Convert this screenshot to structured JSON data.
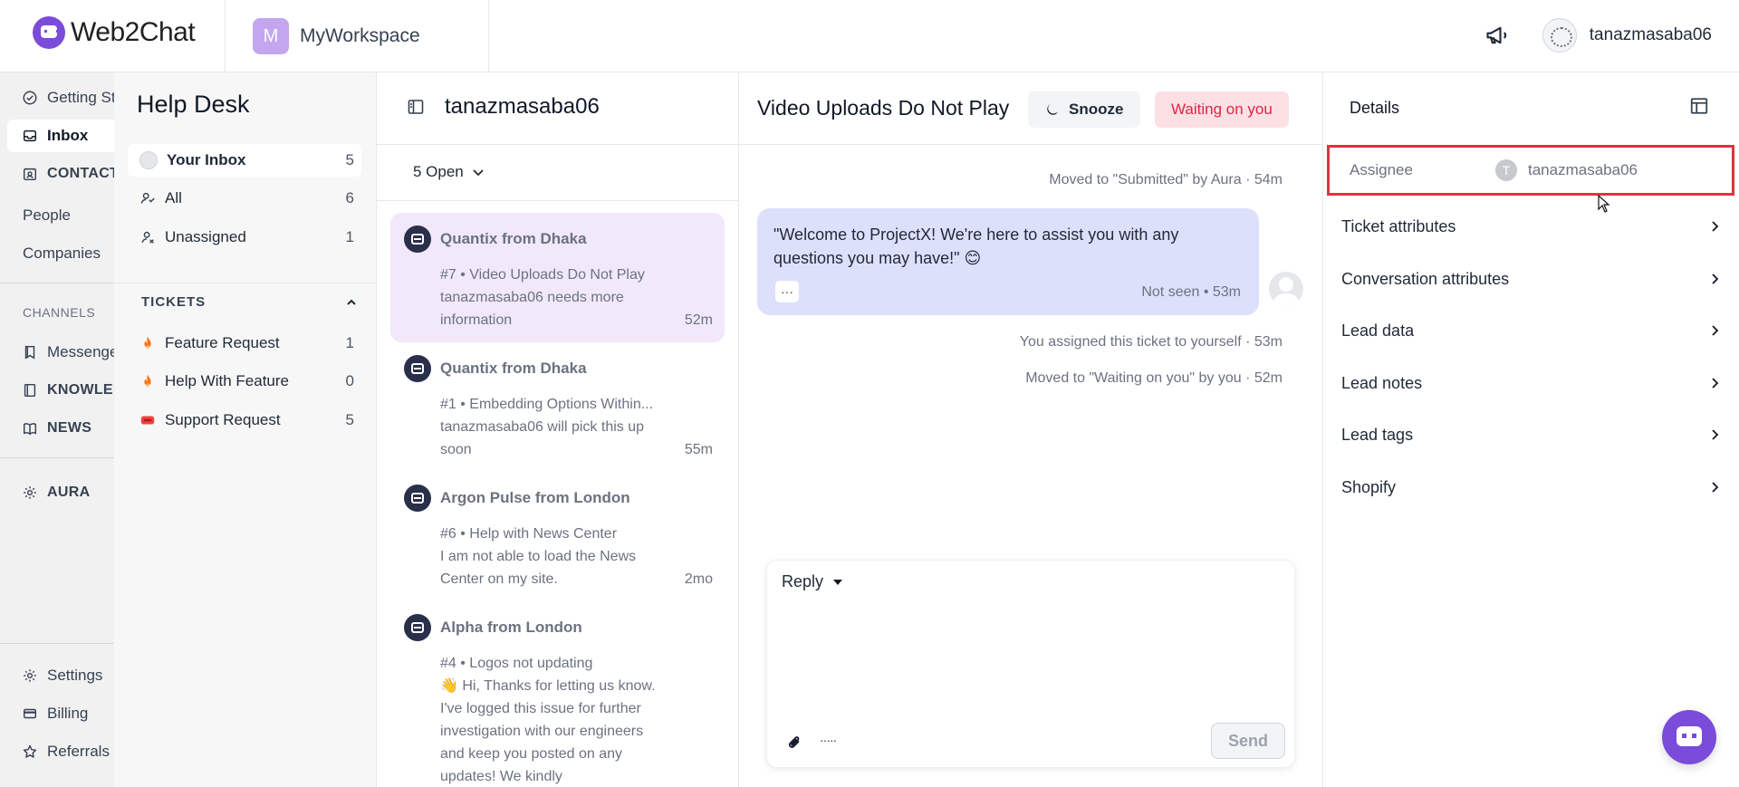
{
  "topbar": {
    "brand_name": "Web2Chat",
    "workspace_initial": "M",
    "workspace_name": "MyWorkspace",
    "username": "tanazmasaba06"
  },
  "leftnav": {
    "items": [
      {
        "label": "Getting Started",
        "icon": "check-circle-icon"
      },
      {
        "label": "Inbox",
        "icon": "inbox-icon"
      },
      {
        "label": "CONTACTS",
        "icon": "contacts-icon"
      },
      {
        "label": "People"
      },
      {
        "label": "Companies"
      }
    ],
    "channels_heading": "CHANNELS",
    "channels": [
      {
        "label": "Messenger",
        "icon": "messenger-icon"
      },
      {
        "label": "KNOWLEDGE",
        "icon": "book-icon"
      },
      {
        "label": "NEWS",
        "icon": "news-icon"
      }
    ],
    "aura_label": "AURA",
    "bottom": [
      {
        "label": "Settings",
        "icon": "gear-icon"
      },
      {
        "label": "Billing",
        "icon": "card-icon"
      },
      {
        "label": "Referrals",
        "icon": "star-icon"
      }
    ]
  },
  "helpdesk": {
    "title": "Help Desk",
    "inboxes": [
      {
        "label": "Your Inbox",
        "count": "5"
      },
      {
        "label": "All",
        "count": "6"
      },
      {
        "label": "Unassigned",
        "count": "1"
      }
    ],
    "tickets_heading": "TICKETS",
    "tickets": [
      {
        "label": "Feature Request",
        "count": "1",
        "color": "#f97316"
      },
      {
        "label": "Help With Feature",
        "count": "0",
        "color": "#f97316"
      },
      {
        "label": "Support Request",
        "count": "5",
        "color": "#ef4444"
      }
    ]
  },
  "convlist": {
    "title": "tanazmasaba06",
    "filter": "5 Open",
    "conversations": [
      {
        "from": "Quantix from Dhaka",
        "subject": "#7 • Video Uploads Do Not Play",
        "preview": "tanazmasaba06 needs more information",
        "time": "52m"
      },
      {
        "from": "Quantix from Dhaka",
        "subject": "#1 • Embedding Options Within...",
        "preview": "tanazmasaba06 will pick this up soon",
        "time": "55m"
      },
      {
        "from": "Argon Pulse from London",
        "subject": "#6 • Help with News Center",
        "preview": "I am not able to load the News Center on my site.",
        "time": "2mo"
      },
      {
        "from": "Alpha from London",
        "subject": "#4 • Logos not updating",
        "preview": "👋 Hi, Thanks for letting us know. I've logged this issue for further investigation with our engineers and keep you posted on any updates! We kindly",
        "time": ""
      }
    ]
  },
  "chat": {
    "title": "Video Uploads Do Not Play",
    "snooze_label": "Snooze",
    "status_label": "Waiting on you",
    "events": [
      "Moved to \"Submitted\" by Aura · 54m",
      "You assigned this ticket to yourself · 53m",
      "Moved to \"Waiting on you\" by you · 52m"
    ],
    "message": {
      "text": "\"Welcome to ProjectX! We're here to assist you with any questions you may have!\" 😊",
      "more": "···",
      "meta": "Not seen • 53m"
    },
    "composer": {
      "reply_type": "Reply",
      "placeholder": "",
      "send_label": "Send"
    }
  },
  "details": {
    "title": "Details",
    "assignee_label": "Assignee",
    "assignee_initial": "T",
    "assignee_name": "tanazmasaba06",
    "sections": [
      "Ticket attributes",
      "Conversation attributes",
      "Lead data",
      "Lead notes",
      "Lead tags",
      "Shopify"
    ]
  },
  "colors": {
    "brand": "#7b4bd9",
    "active_conversation": "#f1e8fb",
    "bubble": "#dde0fb",
    "waiting_bg": "#fde0e4",
    "waiting_text": "#dc2645",
    "highlight_border": "#d9363e"
  }
}
